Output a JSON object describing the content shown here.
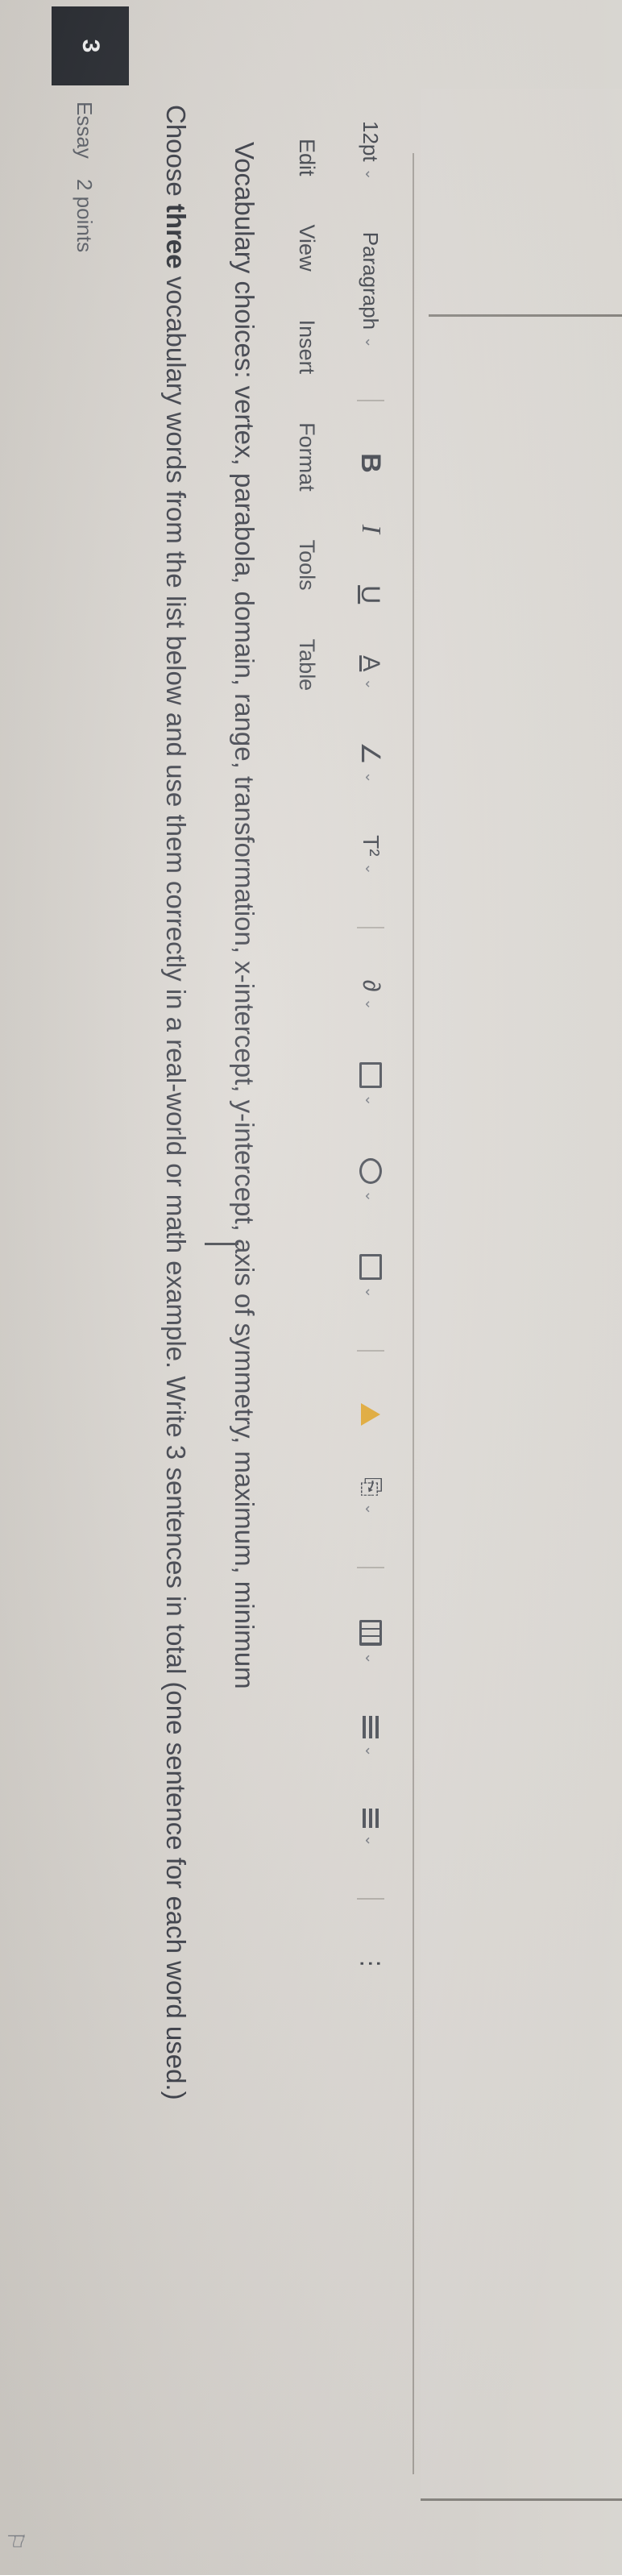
{
  "question": {
    "number": "3",
    "type": "Essay",
    "points": "2 points"
  },
  "prompt": {
    "pre": "Choose ",
    "emphasis": "three",
    "post": " vocabulary words from the list below and use them correctly in a real-world or math example. Write 3 sentences in total (one sentence for each word used.)"
  },
  "vocabulary": {
    "text": "Vocabulary choices: vertex, parabola, domain, range, transformation, x-intercept, y-intercept, axis of symmetry, maximum, minimum"
  },
  "menubar": {
    "items": [
      "Edit",
      "View",
      "Insert",
      "Format",
      "Tools",
      "Table"
    ]
  },
  "toolbar": {
    "font_size": "12pt",
    "block_format": "Paragraph",
    "bold": "B",
    "italic": "I",
    "underline": "U",
    "text_color": "A",
    "highlight": "∠",
    "superscript": "T²",
    "link": "∂",
    "more": "⋮",
    "icons": {
      "link_icon": "link-icon",
      "image_icon": "image-icon",
      "media_icon": "media-icon",
      "embed_icon": "embed-icon",
      "drive_icon": "google-drive-icon",
      "attach_icon": "attach-icon",
      "table_icon": "table-icon",
      "list_icon": "list-icon",
      "paragraph_icon": "paragraph-icon"
    }
  },
  "accent": {
    "drive_yellow": "#e2a72e",
    "question_badge": "#23262c"
  }
}
